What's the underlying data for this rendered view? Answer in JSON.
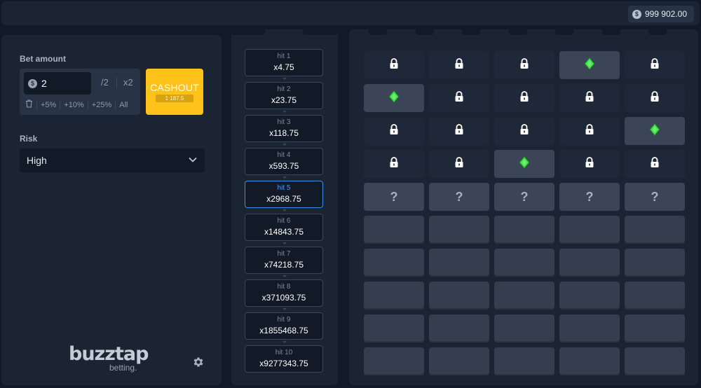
{
  "header": {
    "balance": "999 902.00",
    "currency_icon": "dollar-coin-icon"
  },
  "bet": {
    "label": "Bet amount",
    "currency_symbol": "$",
    "value": "2",
    "half_label": "/2",
    "double_label": "x2",
    "quick": [
      "+5%",
      "+10%",
      "+25%",
      "All"
    ]
  },
  "cashout": {
    "label": "CASHOUT",
    "amount": "1 187.5",
    "color": "#ffc21a"
  },
  "risk": {
    "label": "Risk",
    "value": "High"
  },
  "brand": {
    "name": "buzztap",
    "sub": "betting."
  },
  "hits": [
    {
      "label": "hit 1",
      "mult": "x4.75"
    },
    {
      "label": "hit 2",
      "mult": "x23.75"
    },
    {
      "label": "hit 3",
      "mult": "x118.75"
    },
    {
      "label": "hit 4",
      "mult": "x593.75"
    },
    {
      "label": "hit 5",
      "mult": "x2968.75",
      "active": true
    },
    {
      "label": "hit 6",
      "mult": "x14843.75"
    },
    {
      "label": "hit 7",
      "mult": "x74218.75"
    },
    {
      "label": "hit 8",
      "mult": "x371093.75"
    },
    {
      "label": "hit 9",
      "mult": "x1855468.75"
    },
    {
      "label": "hit 10",
      "mult": "x9277343.75"
    }
  ],
  "grid": {
    "columns": 5,
    "rows": [
      [
        "lock",
        "lock",
        "lock",
        "gem",
        "lock"
      ],
      [
        "gem",
        "lock",
        "lock",
        "lock",
        "lock"
      ],
      [
        "lock",
        "lock",
        "lock",
        "lock",
        "gem"
      ],
      [
        "lock",
        "lock",
        "gem",
        "lock",
        "lock"
      ],
      [
        "?",
        "?",
        "?",
        "?",
        "?"
      ],
      [
        "",
        "",
        "",
        "",
        ""
      ],
      [
        "",
        "",
        "",
        "",
        ""
      ],
      [
        "",
        "",
        "",
        "",
        ""
      ],
      [
        "",
        "",
        "",
        "",
        ""
      ],
      [
        "",
        "",
        "",
        "",
        ""
      ]
    ],
    "gem_color": "#3fe04a",
    "active_color": "#3d8ee8"
  }
}
